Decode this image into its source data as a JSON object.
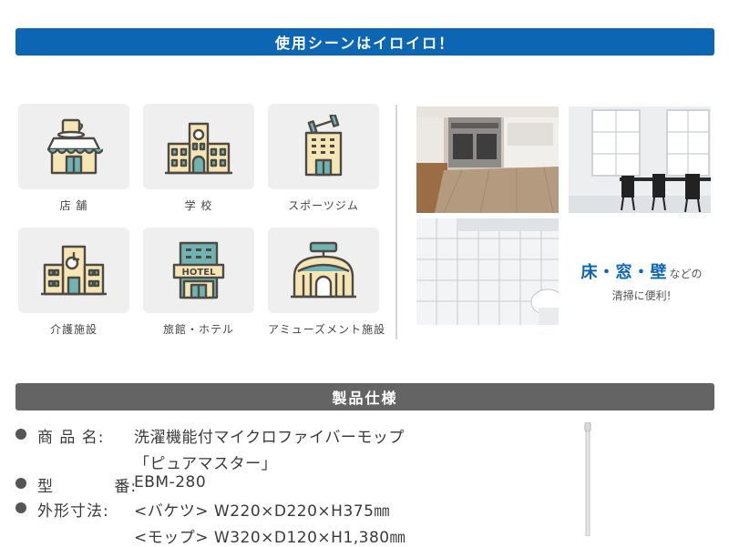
{
  "uses_section": {
    "title": "使用シーンはイロイロ！",
    "tiles": [
      {
        "label": "店 舗",
        "icon": "shop-icon"
      },
      {
        "label": "学 校",
        "icon": "school-icon"
      },
      {
        "label": "スポーツジム",
        "icon": "gym-icon"
      },
      {
        "label": "介護施設",
        "icon": "care-facility-icon"
      },
      {
        "label": "旅館・ホテル",
        "icon": "hotel-icon"
      },
      {
        "label": "アミューズメント施設",
        "icon": "amusement-icon"
      }
    ],
    "hotel_sign": "HOTEL",
    "promo": {
      "line1": "床・窓・壁",
      "line1_suffix": "などの",
      "line2": "清掃に便利!"
    }
  },
  "spec_section": {
    "title": "製品仕様",
    "rows": [
      {
        "label": "商 品 名:",
        "values": [
          "洗濯機能付マイクロファイバーモップ",
          "「ピュアマスター」"
        ]
      },
      {
        "label": "型 番:",
        "values": [
          "EBM-280"
        ]
      },
      {
        "label": "外形寸法:",
        "values": [
          "<バケツ> W220×D220×H375㎜",
          "<モップ> W320×D120×H1,380㎜"
        ]
      }
    ]
  },
  "colors": {
    "accent_blue": "#0d66b4",
    "spec_gray": "#646464",
    "tile_bg": "#efefef",
    "icon_teal": "#6fb3b3",
    "icon_cream": "#f6e5b5",
    "icon_outline": "#4d4a44"
  }
}
